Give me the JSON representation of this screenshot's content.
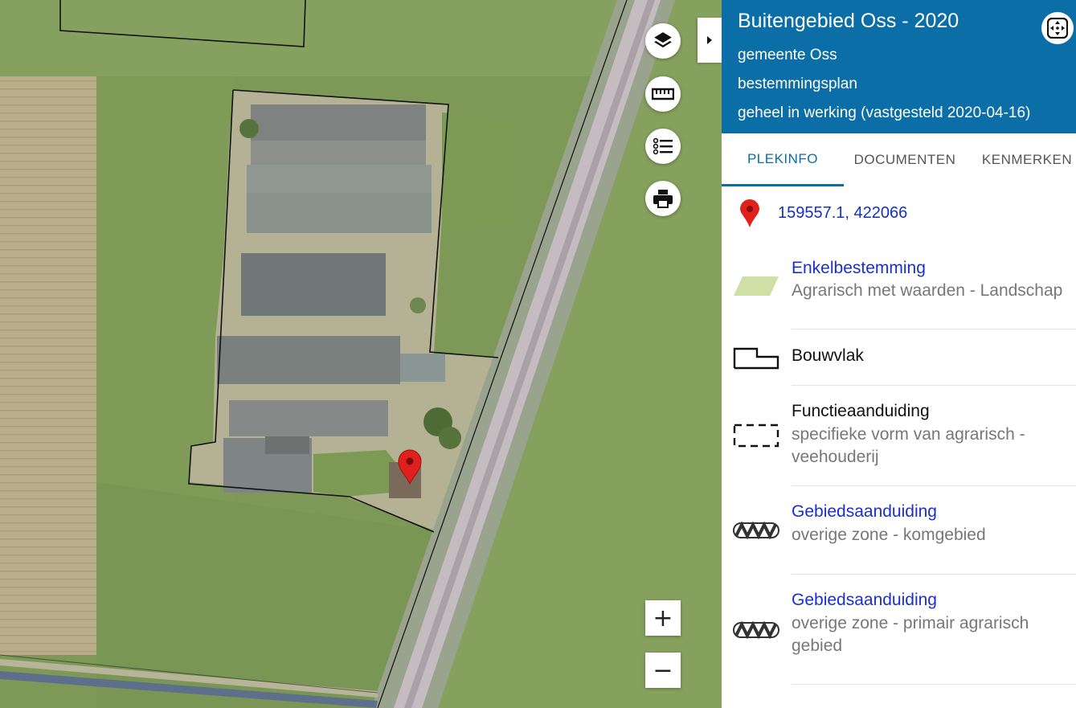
{
  "panel": {
    "title": "Buitengebied Oss - 2020",
    "municipality": "gemeente Oss",
    "plan_type": "bestemmingsplan",
    "status": "geheel in werking (vastgesteld 2020-04-16)",
    "tabs": [
      {
        "label": "PLEKINFO",
        "active": true
      },
      {
        "label": "DOCUMENTEN",
        "active": false
      },
      {
        "label": "KENMERKEN",
        "active": false
      }
    ],
    "coordinates": "159557.1, 422066",
    "items": [
      {
        "name": "Enkelbestemming",
        "description": "Agrarisch met waarden - Landschap",
        "symbol": "green-parallelogram-icon",
        "link": true
      },
      {
        "name": "Bouwvlak",
        "description": "",
        "symbol": "building-plane-outline-icon",
        "link": false
      },
      {
        "name": "Functieaanduiding",
        "description": "specifieke vorm van agrarisch - veehouderij",
        "symbol": "dashed-rectangle-icon",
        "link": false
      },
      {
        "name": "Gebiedsaanduiding",
        "description": "overige zone - komgebied",
        "symbol": "zigzag-band-icon",
        "link": true
      },
      {
        "name": "Gebiedsaanduiding",
        "description": "overige zone - primair agrarisch gebied",
        "symbol": "zigzag-band-icon",
        "link": true
      }
    ]
  },
  "map": {
    "controls": [
      "layers-icon",
      "ruler-icon",
      "legend-list-icon",
      "print-icon"
    ],
    "zoom_in": "+",
    "zoom_out": "−"
  },
  "colors": {
    "header_bg": "#0b6ea6",
    "link": "#1a2fd0",
    "marker": "#e0201c",
    "enkelbestemming_fill": "#cfe0a6"
  }
}
